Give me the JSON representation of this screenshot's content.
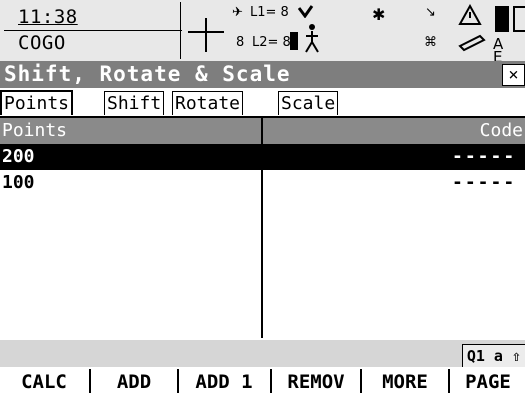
{
  "status": {
    "time": "11:38",
    "app": "COGO",
    "gnss": {
      "l1": "L1= 8",
      "l2": "L2= 8",
      "sats": "8"
    },
    "memory_labels": "A E"
  },
  "title": "Shift, Rotate & Scale",
  "close_glyph": "×",
  "tabs": [
    "Points",
    "Shift",
    "Rotate",
    "Scale"
  ],
  "table": {
    "headers": [
      "Points",
      "Code"
    ],
    "rows": [
      {
        "point": "200",
        "code": "-----",
        "selected": true
      },
      {
        "point": "100",
        "code": "-----",
        "selected": false
      }
    ]
  },
  "indicator": "Q1 a ⇧",
  "softkeys": [
    "CALC",
    "ADD",
    "ADD 1",
    "REMOV",
    "MORE",
    "PAGE"
  ]
}
